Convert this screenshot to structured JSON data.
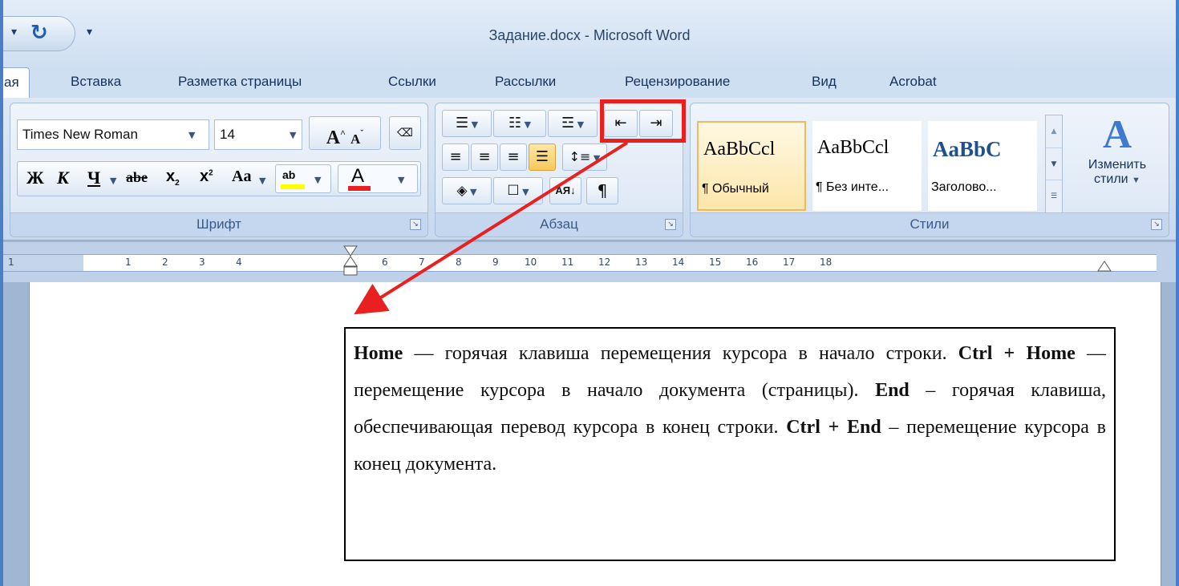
{
  "window": {
    "title": "Задание.docx - Microsoft Word"
  },
  "tabs": [
    {
      "label": "ая",
      "active": true
    },
    {
      "label": "Вставка"
    },
    {
      "label": "Разметка страницы"
    },
    {
      "label": "Ссылки"
    },
    {
      "label": "Рассылки"
    },
    {
      "label": "Рецензирование"
    },
    {
      "label": "Вид"
    },
    {
      "label": "Acrobat"
    }
  ],
  "font_group": {
    "label": "Шрифт",
    "font_name": "Times New Roman",
    "font_size": "14",
    "grow": "A",
    "shrink": "A",
    "bold": "Ж",
    "italic": "К",
    "underline": "Ч",
    "strike": "abe",
    "subscript": "x",
    "superscript": "x",
    "change_case": "Aa",
    "highlight": "ab",
    "font_color": "A"
  },
  "paragraph_group": {
    "label": "Абзац",
    "show_marks": "¶",
    "sort": "АЯ"
  },
  "styles_group": {
    "label": "Стили",
    "change_styles": [
      "Изменить",
      "стили"
    ],
    "tiles": [
      {
        "sample": "AaBbCcl",
        "name": "¶ Обычный",
        "selected": true
      },
      {
        "sample": "AaBbCcl",
        "name": "¶ Без инте..."
      },
      {
        "sample": "AaBbC",
        "name": "Заголово..."
      }
    ]
  },
  "ruler": {
    "labels": [
      "1",
      "1",
      "2",
      "3",
      "4",
      "6",
      "7",
      "8",
      "9",
      "10",
      "11",
      "12",
      "13",
      "14",
      "15",
      "16",
      "17",
      "18"
    ]
  },
  "document": {
    "segments": [
      {
        "text": "Home",
        "bold": true
      },
      {
        "text": " — горячая клавиша перемещения курсора в начало строки. "
      },
      {
        "text": "Ctrl + Home",
        "bold": true
      },
      {
        "text": " — перемещение курсора в начало документа (страницы). "
      },
      {
        "text": "End",
        "bold": true
      },
      {
        "text": " – горячая клавиша, обеспечивающая перевод курсора в конец строки. "
      },
      {
        "text": "Ctrl + End",
        "bold": true
      },
      {
        "text": " – перемещение курсора в конец документа."
      }
    ]
  },
  "annotation": {
    "color": "#e8201f"
  },
  "colors": {
    "ribbon_bg": "#dfe9f5",
    "window_border": "#4a7fc5",
    "selected_style": "#fde6a9"
  }
}
